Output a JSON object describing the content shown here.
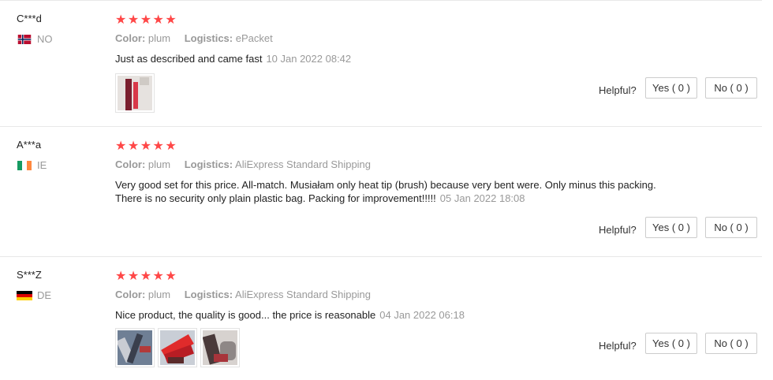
{
  "reviews": [
    {
      "user": "C***d",
      "country": "NO",
      "flag": "flag-norway",
      "stars": "★★★★★",
      "color_key": "Color:",
      "color_val": "plum",
      "logistics_key": "Logistics:",
      "logistics_val": "ePacket",
      "text_lines": [
        "Just as described and came fast"
      ],
      "date": "10 Jan 2022 08:42",
      "helpful_label": "Helpful?",
      "yes_label": "Yes ( 0 )",
      "no_label": "No ( 0 )"
    },
    {
      "user": "A***a",
      "country": "IE",
      "flag": "flag-ireland",
      "stars": "★★★★★",
      "color_key": "Color:",
      "color_val": "plum",
      "logistics_key": "Logistics:",
      "logistics_val": "AliExpress Standard Shipping",
      "text_lines": [
        "Very good set for this price. All-match. Musiałam only heat tip (brush) because very bent were. Only minus this packing.",
        "There is no security only plain plastic bag. Packing for improvement!!!!!"
      ],
      "date": "05 Jan 2022 18:08",
      "helpful_label": "Helpful?",
      "yes_label": "Yes ( 0 )",
      "no_label": "No ( 0 )"
    },
    {
      "user": "S***Z",
      "country": "DE",
      "flag": "flag-germany",
      "stars": "★★★★★",
      "color_key": "Color:",
      "color_val": "plum",
      "logistics_key": "Logistics:",
      "logistics_val": "AliExpress Standard Shipping",
      "text_lines": [
        "Nice product, the quality is good... the price is reasonable"
      ],
      "date": "04 Jan 2022 06:18",
      "helpful_label": "Helpful?",
      "yes_label": "Yes ( 0 )",
      "no_label": "No ( 0 )"
    }
  ],
  "colors": {
    "star": "#ff4747",
    "muted": "#999999",
    "text": "#222222",
    "divider": "#e8e8e8"
  }
}
